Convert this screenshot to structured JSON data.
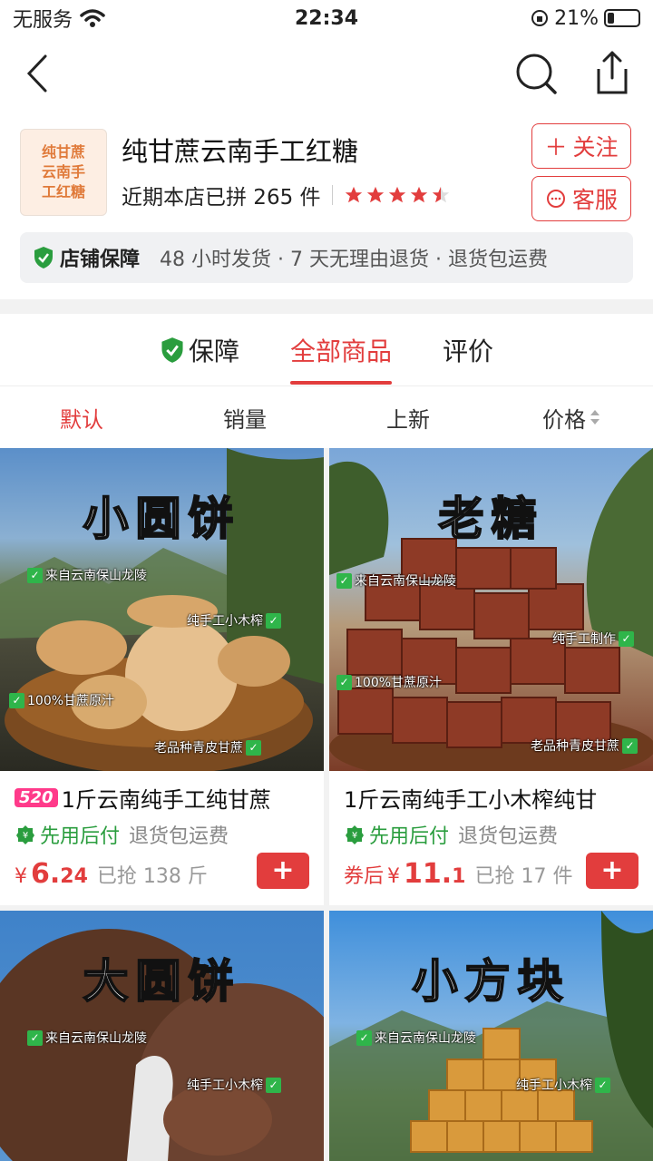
{
  "status": {
    "carrier": "无服务",
    "time": "22:34",
    "battery": "21%"
  },
  "shop": {
    "logo_lines": [
      "纯甘蔗",
      "云南手",
      "工红糖"
    ],
    "name": "纯甘蔗云南手工红糖",
    "stat": "近期本店已拼 265 件",
    "rating": 4.5,
    "follow": "关注",
    "service": "客服",
    "guarantee_title": "店铺保障",
    "guarantee_desc": "48 小时发货 · 7 天无理由退货 · 退货包运费"
  },
  "tabs": [
    {
      "label": "保障"
    },
    {
      "label": "全部商品"
    },
    {
      "label": "评价"
    }
  ],
  "sort": [
    "默认",
    "销量",
    "上新",
    "价格"
  ],
  "products": [
    {
      "image_title": "小圆饼",
      "tags": [
        "来自云南保山龙陵",
        "纯手工小木榨",
        "100%甘蔗原汁",
        "老品种青皮甘蔗"
      ],
      "badge": "520",
      "name": "1斤云南纯手工纯甘蔗",
      "pay": "先用后付",
      "pay_note": "退货包运费",
      "price_prefix": "",
      "price_symbol": "¥",
      "price_int": "6.",
      "price_dec": "24",
      "sold": "已抢 138 斤"
    },
    {
      "image_title": "老糖",
      "tags": [
        "来自云南保山龙陵",
        "纯手工制作",
        "100%甘蔗原汁",
        "老品种青皮甘蔗"
      ],
      "badge": "",
      "name": "1斤云南纯手工小木榨纯甘",
      "pay": "先用后付",
      "pay_note": "退货包运费",
      "price_prefix": "券后",
      "price_symbol": "¥",
      "price_int": "11.",
      "price_dec": "1",
      "sold": "已抢 17 件"
    },
    {
      "image_title": "大圆饼",
      "tags": [
        "来自云南保山龙陵",
        "纯手工小木榨"
      ]
    },
    {
      "image_title": "小方块",
      "tags": [
        "来自云南保山龙陵",
        "纯手工小木榨"
      ]
    }
  ],
  "colors": {
    "accent": "#e23d3d",
    "green": "#2a9d3e"
  }
}
